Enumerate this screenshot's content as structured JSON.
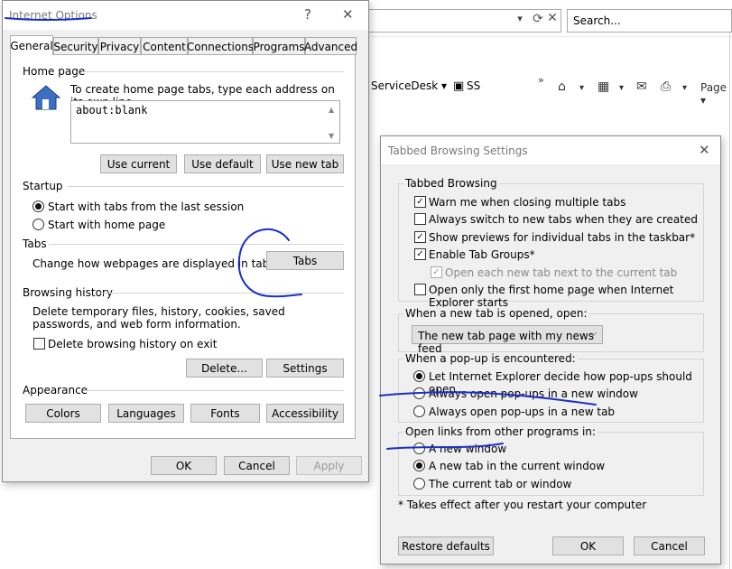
{
  "browser": {
    "search_placeholder": "Search...",
    "favorites": [
      "ServiceDesk ▾",
      "SS"
    ],
    "toolbar_overflow": "»",
    "page_menu": "Page ▾"
  },
  "internet_options": {
    "title": "Internet Options",
    "help": "?",
    "close": "✕",
    "tabs": [
      "General",
      "Security",
      "Privacy",
      "Content",
      "Connections",
      "Programs",
      "Advanced"
    ],
    "home_page": {
      "section": "Home page",
      "description": "To create home page tabs, type each address on its own line.",
      "value": "about:blank",
      "use_current": "Use current",
      "use_default": "Use default",
      "use_new_tab": "Use new tab"
    },
    "startup": {
      "section": "Startup",
      "option_last_session": "Start with tabs from the last session",
      "option_home_page": "Start with home page",
      "selected": "last_session"
    },
    "tabs_section": {
      "section": "Tabs",
      "description": "Change how webpages are displayed in tabs.",
      "button": "Tabs"
    },
    "history": {
      "section": "Browsing history",
      "description": "Delete temporary files, history, cookies, saved passwords, and web form information.",
      "delete_on_exit": "Delete browsing history on exit",
      "delete_button": "Delete...",
      "settings_button": "Settings"
    },
    "appearance": {
      "section": "Appearance",
      "colors": "Colors",
      "languages": "Languages",
      "fonts": "Fonts",
      "accessibility": "Accessibility"
    },
    "ok": "OK",
    "cancel": "Cancel",
    "apply": "Apply"
  },
  "tabbed_settings": {
    "title": "Tabbed Browsing Settings",
    "close": "✕",
    "tabbed_browsing": {
      "group": "Tabbed Browsing",
      "options": [
        {
          "label": "Warn me when closing multiple tabs",
          "checked": true
        },
        {
          "label": "Always switch to new tabs when they are created",
          "checked": false
        },
        {
          "label": "Show previews for individual tabs in the taskbar*",
          "checked": true
        },
        {
          "label": "Enable Tab Groups*",
          "checked": true
        },
        {
          "label": "Open each new tab next to the current tab",
          "checked": true,
          "disabled": true
        },
        {
          "label": "Open only the first home page when Internet Explorer starts",
          "checked": false
        }
      ]
    },
    "new_tab": {
      "group": "When a new tab is opened, open:",
      "selected": "The new tab page with my news feed"
    },
    "popup": {
      "group": "When a pop-up is encountered:",
      "options": [
        "Let Internet Explorer decide how pop-ups should open",
        "Always open pop-ups in a new window",
        "Always open pop-ups in a new tab"
      ],
      "selected_index": 0
    },
    "links": {
      "group": "Open links from other programs in:",
      "options": [
        "A new window",
        "A new tab in the current window",
        "The current tab or window"
      ],
      "selected_index": 1
    },
    "footnote": "* Takes effect after you restart your computer",
    "restore_defaults": "Restore defaults",
    "ok": "OK",
    "cancel": "Cancel"
  },
  "colors": {
    "ink": "#1a2fc8",
    "dialog_bg": "#f0f0f0",
    "button_bg": "#e1e1e1"
  }
}
